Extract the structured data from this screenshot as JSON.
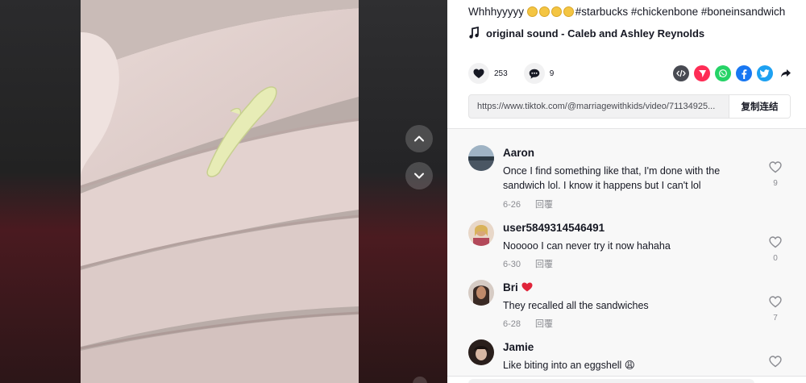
{
  "video": {
    "nav_up_icon": "chevron-up-icon",
    "nav_down_icon": "chevron-down-icon"
  },
  "post": {
    "caption_text": "Whhhyyyyy",
    "caption_emojis": [
      "crying-laughing-emoji",
      "crying-laughing-emoji",
      "crying-laughing-emoji",
      "crying-laughing-emoji"
    ],
    "caption_hashtags": "#starbucks #chickenbone #boneinsandwich",
    "sound": "original sound - Caleb and Ashley Reynolds"
  },
  "actions": {
    "like_count": "253",
    "comment_count": "9",
    "share_icons": [
      "embed-icon",
      "send-icon",
      "whatsapp-icon",
      "facebook-icon",
      "twitter-icon",
      "share-arrow-icon"
    ]
  },
  "link": {
    "url": "https://www.tiktok.com/@marriagewithkids/video/71134925...",
    "copy_label": "复制连结"
  },
  "comments": [
    {
      "name": "Aaron",
      "text": "Once I find something like that, I'm done with the sandwich lol. I know it happens but I can't lol",
      "date": "6-26",
      "reply": "回覆",
      "likes": "9"
    },
    {
      "name": "user5849314546491",
      "text": "Nooooo I can never try it now hahaha",
      "date": "6-30",
      "reply": "回覆",
      "likes": "0"
    },
    {
      "name": "Bri",
      "name_badge": "heart-emoji",
      "text": "They recalled all the sandwiches",
      "date": "6-28",
      "reply": "回覆",
      "likes": "7"
    },
    {
      "name": "Jamie",
      "text": "Like biting into an eggshell 😩",
      "date": "",
      "reply": "",
      "likes": ""
    }
  ],
  "colors": {
    "accent": "#fe2c55",
    "text": "#161823",
    "muted": "#8a8b91",
    "whatsapp": "#25d366",
    "facebook": "#1877f2",
    "twitter": "#1da1f2"
  }
}
